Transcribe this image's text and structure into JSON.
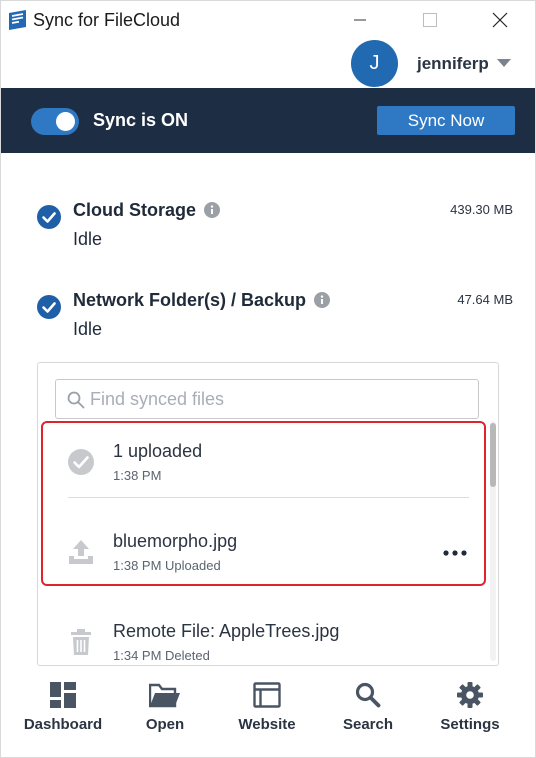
{
  "window": {
    "title": "Sync for FileCloud"
  },
  "user": {
    "initial": "J",
    "name": "jenniferp"
  },
  "sync": {
    "status": "Sync is ON",
    "button": "Sync Now",
    "enabled": true
  },
  "storage": [
    {
      "title": "Cloud Storage",
      "state": "Idle",
      "size": "439.30 MB"
    },
    {
      "title": "Network Folder(s) / Backup",
      "state": "Idle",
      "size": "47.64 MB"
    }
  ],
  "search": {
    "placeholder": "Find synced files"
  },
  "activity": [
    {
      "title": "1 uploaded",
      "sub": "1:38 PM",
      "icon": "check-circle-icon"
    },
    {
      "title": "bluemorpho.jpg",
      "sub": "1:38 PM Uploaded",
      "icon": "upload-icon"
    },
    {
      "title": "Remote File: AppleTrees.jpg",
      "sub": "1:34 PM Deleted",
      "icon": "trash-icon"
    }
  ],
  "nav": [
    {
      "label": "Dashboard",
      "icon": "dashboard-icon"
    },
    {
      "label": "Open",
      "icon": "folder-open-icon"
    },
    {
      "label": "Website",
      "icon": "browser-window-icon"
    },
    {
      "label": "Search",
      "icon": "search-icon"
    },
    {
      "label": "Settings",
      "icon": "gear-icon"
    }
  ],
  "colors": {
    "accent": "#2f78c4",
    "header_bg": "#1d2d44",
    "avatar_bg": "#2169b0",
    "check": "#1f5fa8",
    "highlight_border": "#e0242b"
  }
}
